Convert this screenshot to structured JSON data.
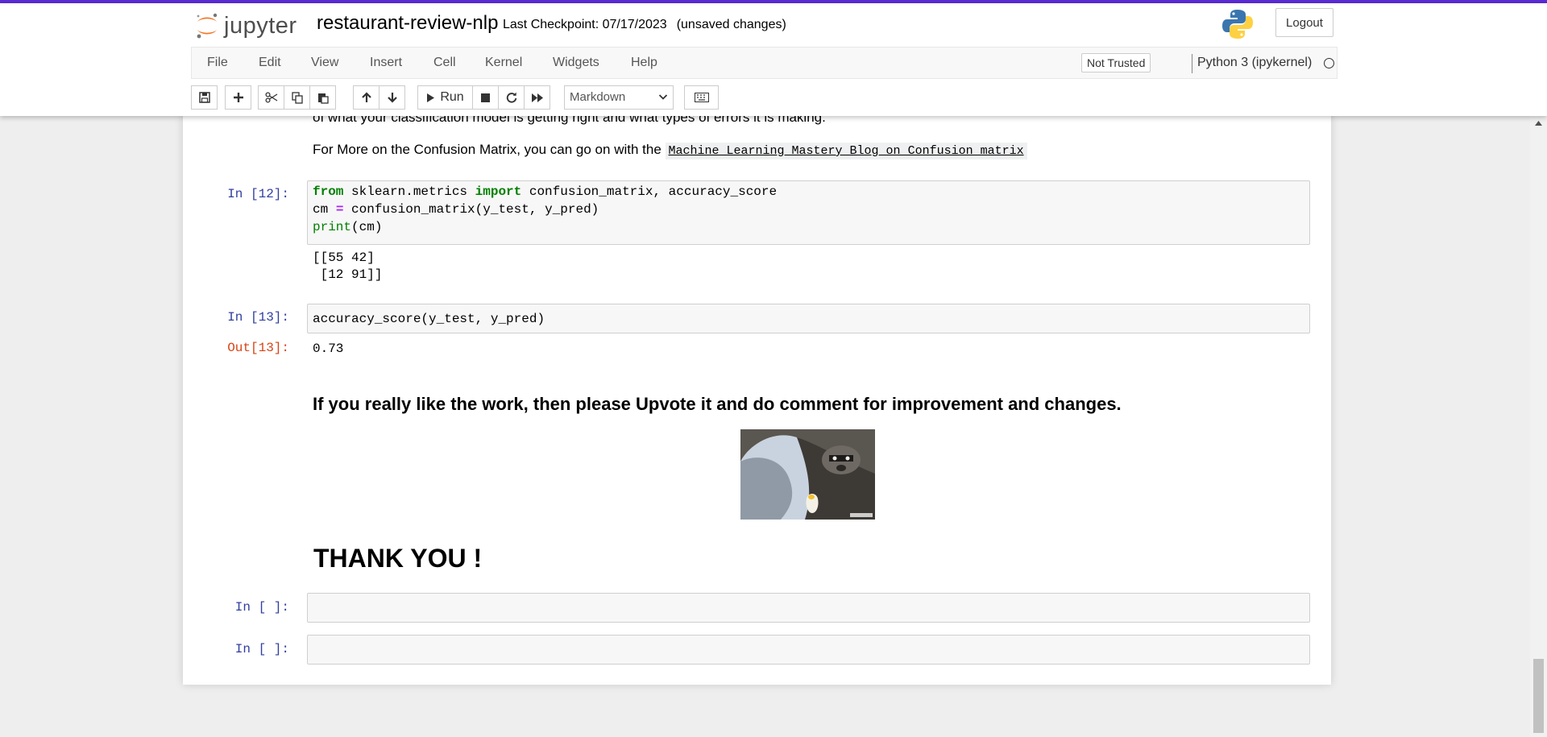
{
  "header": {
    "logo_text": "jupyter",
    "notebook_name": "restaurant-review-nlp",
    "checkpoint": "Last Checkpoint: 07/17/2023",
    "save_status": "(unsaved changes)",
    "logout_label": "Logout"
  },
  "menu": {
    "items": [
      "File",
      "Edit",
      "View",
      "Insert",
      "Cell",
      "Kernel",
      "Widgets",
      "Help"
    ],
    "trust_label": "Not Trusted",
    "kernel_name": "Python 3 (ipykernel)"
  },
  "toolbar": {
    "run_label": "Run",
    "cell_type": "Markdown",
    "icons": [
      "save-icon",
      "plus-icon",
      "scissors-icon",
      "copy-icon",
      "paste-icon",
      "arrow-up-icon",
      "arrow-down-icon",
      "play-icon",
      "stop-icon",
      "restart-icon",
      "fast-forward-icon",
      "keyboard-icon"
    ]
  },
  "cells": {
    "md_partial": "of what your classification model is getting right and what types of errors it is making.",
    "md_link_prefix": "For More on the Confusion Matrix, you can go on with the",
    "md_link_text": "Machine Learning Mastery Blog on Confusion matrix",
    "cell12_prompt": "In [12]:",
    "cell12_code": {
      "l1_kw1": "from",
      "l1_mod": " sklearn.metrics ",
      "l1_kw2": "import",
      "l1_rest": " confusion_matrix, accuracy_score",
      "l2_a": "cm ",
      "l2_op": "=",
      "l2_b": " confusion_matrix(y_test, y_pred)",
      "l3_fn": "print",
      "l3_rest": "(cm)"
    },
    "cell12_output": "[[55 42]\n [12 91]]",
    "cell13_prompt": "In [13]:",
    "cell13_code": "accuracy_score(y_test, y_pred)",
    "cell13_out_prompt": "Out[13]:",
    "cell13_output": "0.73",
    "upvote_heading": "If you really like the work, then please Upvote it and do comment for improvement and changes.",
    "thanks_heading": "THANK YOU !",
    "empty_prompt": "In [ ]:"
  },
  "colors": {
    "accent": "#5b2bd6",
    "prompt_in": "#303f9f",
    "prompt_out": "#d84315",
    "keyword": "#008000"
  }
}
